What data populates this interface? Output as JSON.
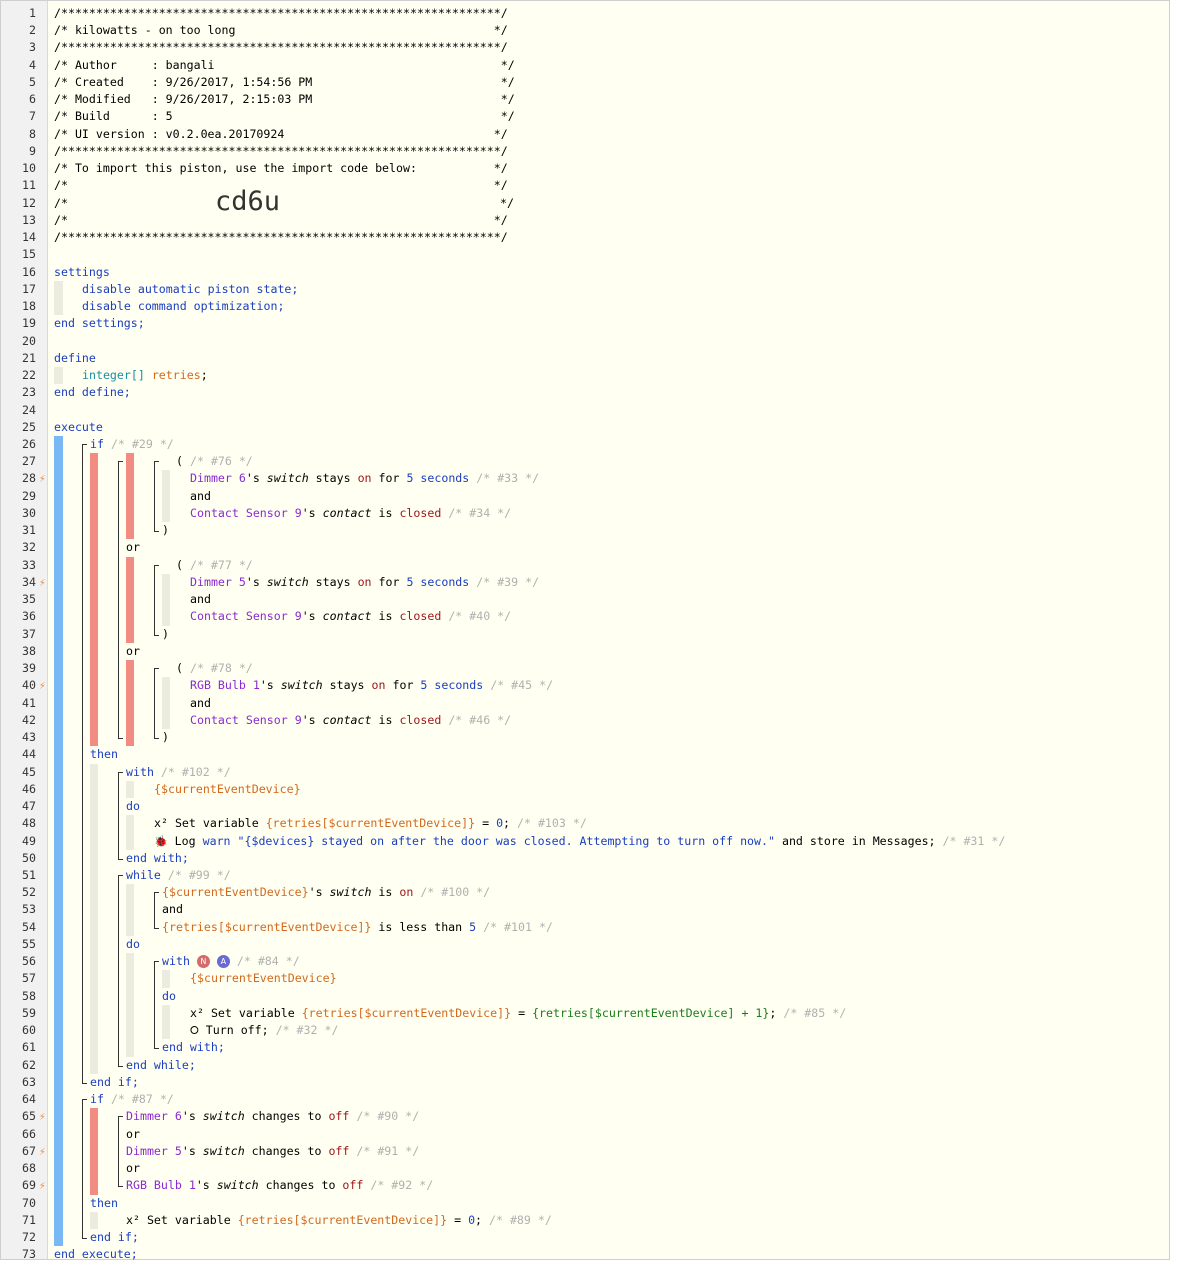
{
  "header": {
    "stars": "/***************************************************************/",
    "title_line": "/* kilowatts - on too long                                     */",
    "author_line": "/* Author     : bangali                                         */",
    "created_line": "/* Created    : 9/26/2017, 1:54:56 PM                           */",
    "modified_line": "/* Modified   : 9/26/2017, 2:15:03 PM                           */",
    "build_line": "/* Build      : 5                                               */",
    "ui_line": "/* UI version : v0.2.0ea.20170924                              */",
    "import_line": "/* To import this piston, use the import code below:           */",
    "blank_line": "/*                                                             */",
    "code_prefix": "/*",
    "code_suffix": "*/",
    "import_code": "cd6u"
  },
  "line_numbers": [
    "1",
    "2",
    "3",
    "4",
    "5",
    "6",
    "7",
    "8",
    "9",
    "10",
    "11",
    "12",
    "13",
    "14",
    "15",
    "16",
    "17",
    "18",
    "19",
    "20",
    "21",
    "22",
    "23",
    "24",
    "25",
    "26",
    "27",
    "28",
    "29",
    "30",
    "31",
    "32",
    "33",
    "34",
    "35",
    "36",
    "37",
    "38",
    "39",
    "40",
    "41",
    "42",
    "43",
    "44",
    "45",
    "46",
    "47",
    "48",
    "49",
    "50",
    "51",
    "52",
    "53",
    "54",
    "55",
    "56",
    "57",
    "58",
    "59",
    "60",
    "61",
    "62",
    "63",
    "64",
    "65",
    "66",
    "67",
    "68",
    "69",
    "70",
    "71",
    "72",
    "73"
  ],
  "lightning_glyph": "⚡",
  "settings": {
    "open": "settings",
    "opt1": "disable automatic piston state;",
    "opt2": "disable command optimization;",
    "close": "end settings;"
  },
  "define": {
    "open": "define",
    "type": "integer[]",
    "name": "retries",
    "semi": ";",
    "close": "end define;"
  },
  "execute": {
    "open": "execute",
    "close": "end execute;"
  },
  "kw": {
    "if": "if",
    "then": "then",
    "or": "or",
    "and": "and",
    "do": "do",
    "with": "with",
    "end_with": "end with;",
    "while": "while",
    "end_while": "end while;",
    "end_if": "end if;",
    "paren_open": "(",
    "paren_close": ")",
    "s_switch": "'s ",
    "switch": "switch",
    "contact": "contact",
    "stays": " stays ",
    "for": " for ",
    "is": " is ",
    "on": "on",
    "closed": "closed",
    "off": "off",
    "changes_to": " changes to ",
    "seconds": "seconds"
  },
  "comments": {
    "c29": "/* #29 */",
    "c76": "/* #76 */",
    "c33": "/* #33 */",
    "c34": "/* #34 */",
    "c77": "/* #77 */",
    "c39": "/* #39 */",
    "c40": "/* #40 */",
    "c78": "/* #78 */",
    "c45": "/* #45 */",
    "c46": "/* #46 */",
    "c102": "/* #102 */",
    "c103": "/* #103 */",
    "c31": "/* #31 */",
    "c99": "/* #99 */",
    "c100": "/* #100 */",
    "c101": "/* #101 */",
    "c84": "/* #84 */",
    "c85": "/* #85 */",
    "c32": "/* #32 */",
    "c87": "/* #87 */",
    "c90": "/* #90 */",
    "c91": "/* #91 */",
    "c92": "/* #92 */",
    "c89": "/* #89 */"
  },
  "devices": {
    "dimmer6": "Dimmer 6",
    "dimmer5": "Dimmer 5",
    "rgb1": "RGB Bulb 1",
    "contact9": "Contact Sensor 9"
  },
  "values": {
    "five": "5",
    "zero": "0",
    "one": "1"
  },
  "vars": {
    "ced": "{$currentEventDevice}",
    "retries_ced": "{retries[$currentEventDevice]}",
    "retries_ced_plus": "{retries[$currentEventDevice] + 1}"
  },
  "actions": {
    "set_variable": " Set variable ",
    "eq": " = ",
    "semi": ";",
    "x2": "x²",
    "log": " Log ",
    "warn": "warn",
    "log_msg": "\"{$devices} stayed on after the door was closed. Attempting to turn off now.\"",
    "and_store": " and store in Messages;",
    "turn_off": " Turn off;",
    "is_less_than": " is less than ",
    "bug_icon": "🐞",
    "power_icon": "⭘",
    "badge_n": "N",
    "badge_a": "A"
  },
  "colors": {
    "background": "#fffff2",
    "gutter": "#f1f1f1",
    "blue_bar": "#7ab8f5",
    "red_bar": "#f28b82",
    "gray_bar": "#ebebdf",
    "keyword": "#1a3ec0",
    "device": "#8a2bd1",
    "variable": "#d2691e"
  }
}
